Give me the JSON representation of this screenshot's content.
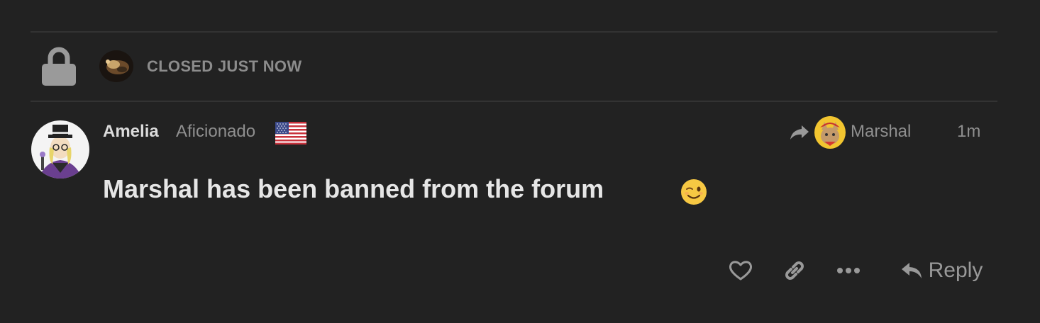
{
  "small_action": {
    "text": "CLOSED JUST NOW",
    "icon": "lock-icon"
  },
  "post": {
    "username": "Amelia",
    "user_title": "Aficionado",
    "flag": "us-flag-icon",
    "reply_to": {
      "icon": "share-arrow-icon",
      "username": "Marshal"
    },
    "date": "1m",
    "body": "Marshal has been banned from the forum",
    "emoji": "wink-emoji"
  },
  "actions": {
    "like_icon": "heart-icon",
    "link_icon": "link-icon",
    "more_icon": "ellipsis-icon",
    "reply_icon": "reply-arrow-icon",
    "reply_label": "Reply"
  },
  "colors": {
    "background": "#222222",
    "divider": "#333333",
    "muted_text": "#8f8f8f",
    "primary_text": "#e6e6e6"
  }
}
